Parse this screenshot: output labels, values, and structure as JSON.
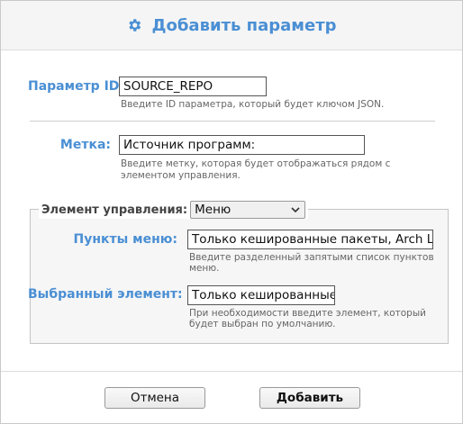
{
  "dialog": {
    "title": "Добавить параметр",
    "title_icon": "gear-icon",
    "accent_color": "#4a8fd4"
  },
  "param_id": {
    "label": "Параметр ID:",
    "value": "SOURCE_REPO",
    "hint": "Введите ID параметра, который будет ключом JSON."
  },
  "mark": {
    "label": "Метка:",
    "value": "Источник программ:",
    "hint_line1": "Введите метку, которая будет отображаться рядом с",
    "hint_line2": "элементом управления."
  },
  "control": {
    "legend_label": "Элемент управления:",
    "selected": "Меню",
    "menu_items": {
      "label": "Пункты меню:",
      "value": "Только кешированные пакеты, Arch Linux",
      "hint_line1": "Введите разделенный запятыми список пунктов",
      "hint_line2": "меню."
    },
    "selected_item": {
      "label": "Выбранный элемент:",
      "value": "Только кешированные па",
      "hint_line1": "При необходимости введите элемент, который",
      "hint_line2": "будет выбран по умолчанию."
    }
  },
  "buttons": {
    "cancel": "Отмена",
    "add": "Добавить"
  }
}
